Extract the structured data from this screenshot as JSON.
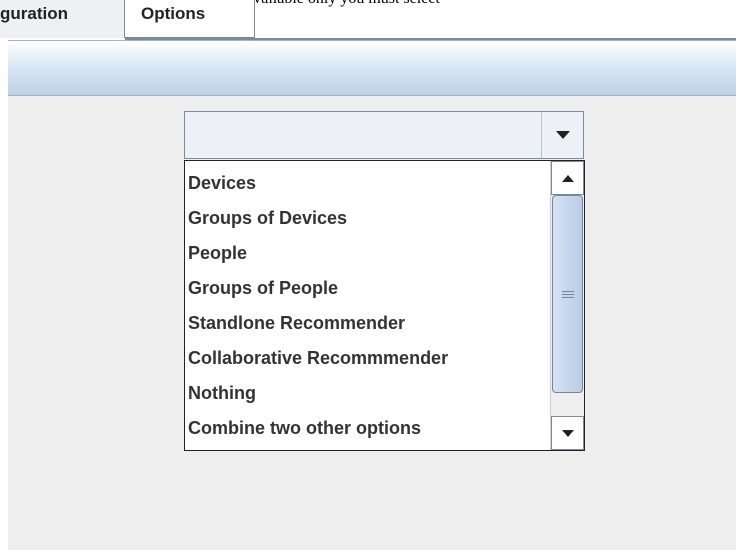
{
  "top_text": "select between all the available inputs available only you must select",
  "tabs": [
    {
      "label": "guration",
      "active": true
    },
    {
      "label": "Options",
      "active": false
    }
  ],
  "combo": {
    "selected_value": "",
    "options": [
      "Devices",
      "Groups of Devices",
      "People",
      "Groups of People",
      "Standlone Recommender",
      "Collaborative Recommmender",
      "Nothing",
      "Combine two other options"
    ]
  },
  "icons": {
    "combo_arrow": "chevron-down-icon",
    "scroll_up": "arrow-up-icon",
    "scroll_down": "arrow-down-icon",
    "thumb_grip": "grip-icon"
  },
  "colors": {
    "panel_bg": "#eeeeee",
    "band_top": "#ffffff",
    "band_bottom": "#bcd0e6",
    "border": "#7a8aa0",
    "text": "#333333"
  }
}
